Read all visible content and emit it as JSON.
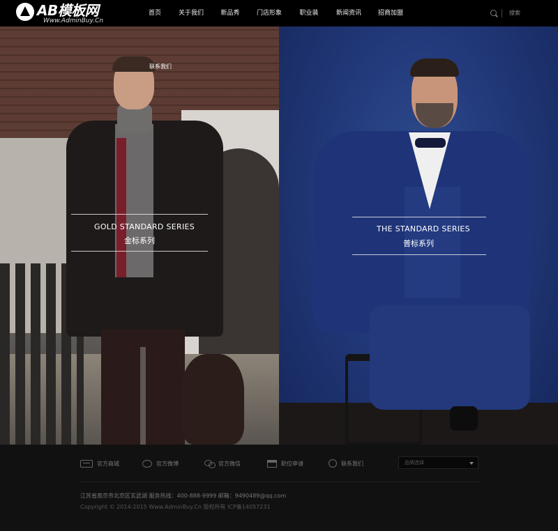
{
  "header": {
    "logo_title": "AB模板网",
    "logo_sub": "Www.AdminBuy.Cn",
    "nav": [
      "首页",
      "关于我们",
      "新品秀",
      "门店形象",
      "职业装",
      "新闻资讯",
      "招商加盟"
    ],
    "search_label": "搜索"
  },
  "banner": {
    "floating_label": "联系我们",
    "left": {
      "title_en": "GOLD STANDARD SERIES",
      "title_cn": "金标系列"
    },
    "right": {
      "title_en": "THE STANDARD SERIES",
      "title_cn": "普标系列"
    }
  },
  "footer": {
    "links": [
      {
        "icon": "tmall-icon",
        "label": "官方商城"
      },
      {
        "icon": "weibo-icon",
        "label": "官方微博"
      },
      {
        "icon": "wechat-icon",
        "label": "官方微信"
      },
      {
        "icon": "shop-icon",
        "label": "职位申请"
      },
      {
        "icon": "contact-icon",
        "label": "联系我们"
      }
    ],
    "select_placeholder": "品牌选择",
    "address": "江苏省南京市北京区玄武湖 服务热线：400-888-9999 邮箱：9490489@qq.com",
    "copyright": "Copyright © 2014-2015 Www.AdminBuy.Cn 版权所有 ICP备14057231"
  }
}
